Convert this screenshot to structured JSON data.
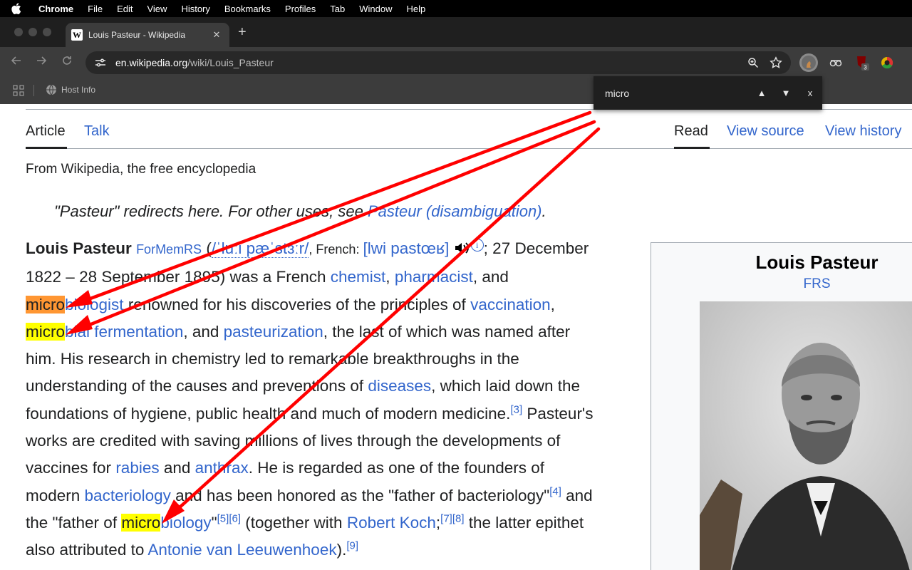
{
  "menubar": {
    "app_name": "Chrome",
    "items": [
      "File",
      "Edit",
      "View",
      "History",
      "Bookmarks",
      "Profiles",
      "Tab",
      "Window",
      "Help"
    ]
  },
  "tab": {
    "favicon": "W",
    "title": "Louis Pasteur - Wikipedia",
    "close": "✕",
    "new_tab": "+"
  },
  "toolbar": {
    "url_host": "en.wikipedia.org",
    "url_path": "/wiki/Louis_Pasteur",
    "icons": [
      "back-arrow-icon",
      "forward-arrow-icon",
      "reload-icon",
      "site-settings-icon",
      "zoom-icon",
      "bookmark-star-icon"
    ],
    "extension_badge": "3"
  },
  "bookmarks": {
    "item": "Host Info"
  },
  "findbar": {
    "query": "micro",
    "prev": "▲",
    "next": "▼",
    "close": "x"
  },
  "article": {
    "tab_article": "Article",
    "tab_talk": "Talk",
    "tab_read": "Read",
    "tab_view_source": "View source",
    "tab_view_history": "View history",
    "from_line": "From Wikipedia, the free encyclopedia",
    "hatnote_prefix": "\"Pasteur\" redirects here. For other uses, see ",
    "hatnote_link": "Pasteur (disambiguation)",
    "hatnote_suffix": ".",
    "lines": {
      "l1": {
        "name": "Louis Pasteur",
        "formem": "ForMemRS",
        "open": " (",
        "ipa_en": "/ˈluːi pæˈstɜːr/",
        "french_label": ", French: ",
        "ipa_fr": "[lwi pastœʁ]",
        "info": "i",
        "date_start": "; 27 December"
      },
      "l2": {
        "a": "1822 – 28 September 1895) was a French ",
        "chemist": "chemist",
        "comma": ", ",
        "pharmacist": "pharmacist",
        "b": ", and"
      },
      "l3": {
        "hl": "micro",
        "link": "biologist",
        "a": " renowned for his discoveries of the principles of ",
        "vaccination": "vaccination",
        "b": ","
      },
      "l4": {
        "hl": "micro",
        "link1": "bial fermentation",
        "a": ", and ",
        "pasteurization": "pasteurization",
        "b": ", the last of which was named after"
      },
      "l5": "him. His research in chemistry led to remarkable breakthroughs in the",
      "l6": {
        "a": "understanding of the causes and preventions of ",
        "diseases": "diseases",
        "b": ", which laid down the"
      },
      "l7": {
        "a": "foundations of hygiene, public health and much of modern medicine.",
        "ref": "[3]",
        "b": " Pasteur's"
      },
      "l8": "works are credited with saving millions of lives through the developments of",
      "l9": {
        "a": "vaccines for ",
        "rabies": "rabies",
        "b": " and ",
        "anthrax": "anthrax",
        "c": ". He is regarded as one of the founders of"
      },
      "l10": {
        "a": "modern ",
        "bacteriology": "bacteriology",
        "b": " and has been honored as the \"father of bacteriology\"",
        "ref": "[4]",
        "c": " and"
      },
      "l11": {
        "a": "the \"father of ",
        "hl": "micro",
        "link": "biology",
        "b": "\"",
        "ref56": "[5][6]",
        "c": " (together with ",
        "koch": "Robert Koch",
        "d": ";",
        "ref78": "[7][8]",
        "e": " the latter epithet"
      },
      "l12": {
        "a": "also attributed to ",
        "leeuwenhoek": "Antonie van Leeuwenhoek",
        "b": ").",
        "ref": "[9]"
      }
    }
  },
  "infobox": {
    "name": "Louis Pasteur",
    "postnominal": "FRS"
  },
  "colors": {
    "link": "#3366cc",
    "current_match": "#ff9632",
    "match": "#ffff00",
    "annotation_arrow": "#ff0000"
  }
}
